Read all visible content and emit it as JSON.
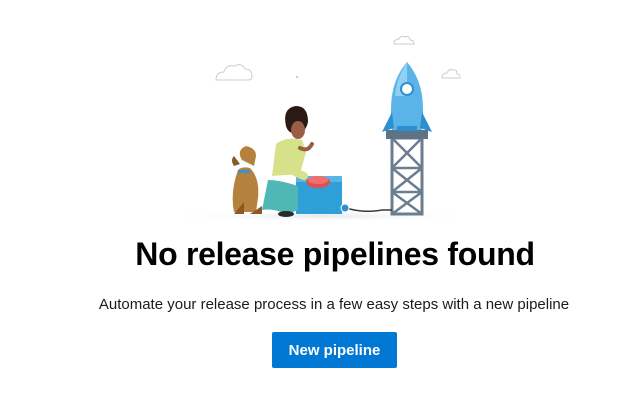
{
  "empty_state": {
    "illustration_icon": "rocket-launch-illustration",
    "title": "No release pipelines found",
    "description": "Automate your release process in a few easy steps with a new pipeline",
    "new_pipeline_label": "New pipeline"
  },
  "colors": {
    "accent": "#0078d4",
    "title_text": "#000000",
    "body_text": "#1b1b1b",
    "background": "#ffffff"
  }
}
